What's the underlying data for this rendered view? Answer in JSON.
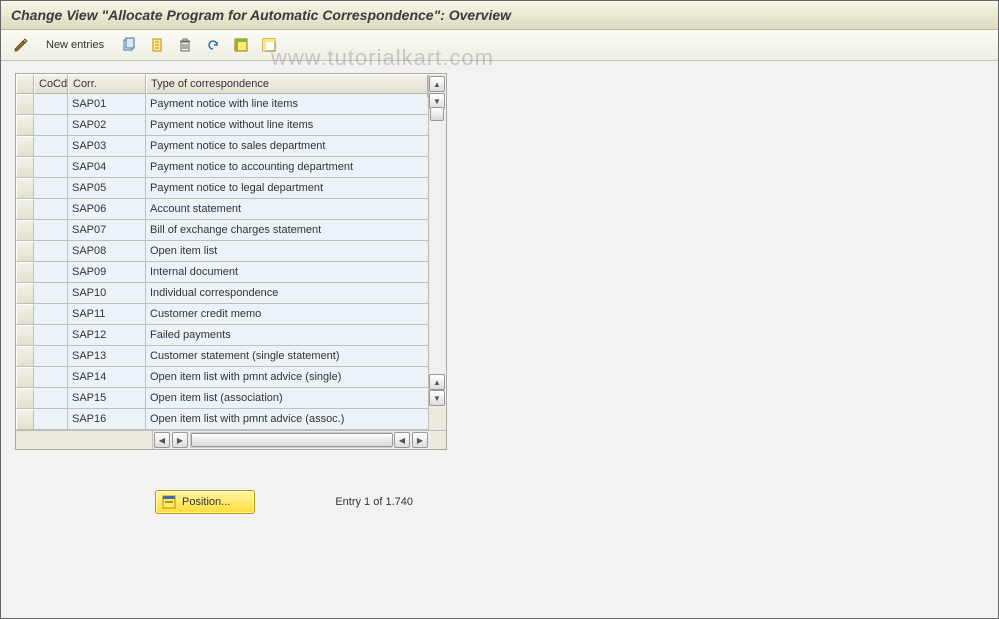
{
  "title": "Change View \"Allocate Program for Automatic Correspondence\": Overview",
  "watermark": "www.tutorialkart.com",
  "toolbar": {
    "new_entries": "New entries"
  },
  "table": {
    "headers": {
      "cocd": "CoCd",
      "corr": "Corr.",
      "type": "Type of correspondence"
    },
    "rows": [
      {
        "cocd": "",
        "corr": "SAP01",
        "type": "Payment notice with line items"
      },
      {
        "cocd": "",
        "corr": "SAP02",
        "type": "Payment notice without line items"
      },
      {
        "cocd": "",
        "corr": "SAP03",
        "type": "Payment notice to sales department"
      },
      {
        "cocd": "",
        "corr": "SAP04",
        "type": "Payment notice to accounting department"
      },
      {
        "cocd": "",
        "corr": "SAP05",
        "type": "Payment notice to legal department"
      },
      {
        "cocd": "",
        "corr": "SAP06",
        "type": "Account statement"
      },
      {
        "cocd": "",
        "corr": "SAP07",
        "type": "Bill of exchange charges statement"
      },
      {
        "cocd": "",
        "corr": "SAP08",
        "type": "Open item list"
      },
      {
        "cocd": "",
        "corr": "SAP09",
        "type": "Internal document"
      },
      {
        "cocd": "",
        "corr": "SAP10",
        "type": "Individual correspondence"
      },
      {
        "cocd": "",
        "corr": "SAP11",
        "type": "Customer credit memo"
      },
      {
        "cocd": "",
        "corr": "SAP12",
        "type": "Failed payments"
      },
      {
        "cocd": "",
        "corr": "SAP13",
        "type": "Customer statement (single statement)"
      },
      {
        "cocd": "",
        "corr": "SAP14",
        "type": "Open item list with pmnt advice (single)"
      },
      {
        "cocd": "",
        "corr": "SAP15",
        "type": "Open item list (association)"
      },
      {
        "cocd": "",
        "corr": "SAP16",
        "type": "Open item list with pmnt advice (assoc.)"
      }
    ]
  },
  "footer": {
    "position_label": "Position...",
    "entry_label": "Entry 1 of 1.740"
  }
}
